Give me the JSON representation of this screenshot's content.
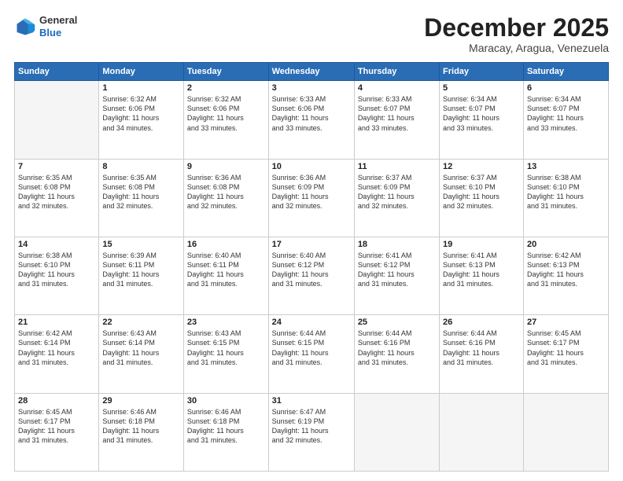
{
  "logo": {
    "line1": "General",
    "line2": "Blue"
  },
  "header": {
    "month": "December 2025",
    "location": "Maracay, Aragua, Venezuela"
  },
  "weekdays": [
    "Sunday",
    "Monday",
    "Tuesday",
    "Wednesday",
    "Thursday",
    "Friday",
    "Saturday"
  ],
  "weeks": [
    [
      {
        "day": "",
        "info": ""
      },
      {
        "day": "1",
        "info": "Sunrise: 6:32 AM\nSunset: 6:06 PM\nDaylight: 11 hours\nand 34 minutes."
      },
      {
        "day": "2",
        "info": "Sunrise: 6:32 AM\nSunset: 6:06 PM\nDaylight: 11 hours\nand 33 minutes."
      },
      {
        "day": "3",
        "info": "Sunrise: 6:33 AM\nSunset: 6:06 PM\nDaylight: 11 hours\nand 33 minutes."
      },
      {
        "day": "4",
        "info": "Sunrise: 6:33 AM\nSunset: 6:07 PM\nDaylight: 11 hours\nand 33 minutes."
      },
      {
        "day": "5",
        "info": "Sunrise: 6:34 AM\nSunset: 6:07 PM\nDaylight: 11 hours\nand 33 minutes."
      },
      {
        "day": "6",
        "info": "Sunrise: 6:34 AM\nSunset: 6:07 PM\nDaylight: 11 hours\nand 33 minutes."
      }
    ],
    [
      {
        "day": "7",
        "info": "Sunrise: 6:35 AM\nSunset: 6:08 PM\nDaylight: 11 hours\nand 32 minutes."
      },
      {
        "day": "8",
        "info": "Sunrise: 6:35 AM\nSunset: 6:08 PM\nDaylight: 11 hours\nand 32 minutes."
      },
      {
        "day": "9",
        "info": "Sunrise: 6:36 AM\nSunset: 6:08 PM\nDaylight: 11 hours\nand 32 minutes."
      },
      {
        "day": "10",
        "info": "Sunrise: 6:36 AM\nSunset: 6:09 PM\nDaylight: 11 hours\nand 32 minutes."
      },
      {
        "day": "11",
        "info": "Sunrise: 6:37 AM\nSunset: 6:09 PM\nDaylight: 11 hours\nand 32 minutes."
      },
      {
        "day": "12",
        "info": "Sunrise: 6:37 AM\nSunset: 6:10 PM\nDaylight: 11 hours\nand 32 minutes."
      },
      {
        "day": "13",
        "info": "Sunrise: 6:38 AM\nSunset: 6:10 PM\nDaylight: 11 hours\nand 31 minutes."
      }
    ],
    [
      {
        "day": "14",
        "info": "Sunrise: 6:38 AM\nSunset: 6:10 PM\nDaylight: 11 hours\nand 31 minutes."
      },
      {
        "day": "15",
        "info": "Sunrise: 6:39 AM\nSunset: 6:11 PM\nDaylight: 11 hours\nand 31 minutes."
      },
      {
        "day": "16",
        "info": "Sunrise: 6:40 AM\nSunset: 6:11 PM\nDaylight: 11 hours\nand 31 minutes."
      },
      {
        "day": "17",
        "info": "Sunrise: 6:40 AM\nSunset: 6:12 PM\nDaylight: 11 hours\nand 31 minutes."
      },
      {
        "day": "18",
        "info": "Sunrise: 6:41 AM\nSunset: 6:12 PM\nDaylight: 11 hours\nand 31 minutes."
      },
      {
        "day": "19",
        "info": "Sunrise: 6:41 AM\nSunset: 6:13 PM\nDaylight: 11 hours\nand 31 minutes."
      },
      {
        "day": "20",
        "info": "Sunrise: 6:42 AM\nSunset: 6:13 PM\nDaylight: 11 hours\nand 31 minutes."
      }
    ],
    [
      {
        "day": "21",
        "info": "Sunrise: 6:42 AM\nSunset: 6:14 PM\nDaylight: 11 hours\nand 31 minutes."
      },
      {
        "day": "22",
        "info": "Sunrise: 6:43 AM\nSunset: 6:14 PM\nDaylight: 11 hours\nand 31 minutes."
      },
      {
        "day": "23",
        "info": "Sunrise: 6:43 AM\nSunset: 6:15 PM\nDaylight: 11 hours\nand 31 minutes."
      },
      {
        "day": "24",
        "info": "Sunrise: 6:44 AM\nSunset: 6:15 PM\nDaylight: 11 hours\nand 31 minutes."
      },
      {
        "day": "25",
        "info": "Sunrise: 6:44 AM\nSunset: 6:16 PM\nDaylight: 11 hours\nand 31 minutes."
      },
      {
        "day": "26",
        "info": "Sunrise: 6:44 AM\nSunset: 6:16 PM\nDaylight: 11 hours\nand 31 minutes."
      },
      {
        "day": "27",
        "info": "Sunrise: 6:45 AM\nSunset: 6:17 PM\nDaylight: 11 hours\nand 31 minutes."
      }
    ],
    [
      {
        "day": "28",
        "info": "Sunrise: 6:45 AM\nSunset: 6:17 PM\nDaylight: 11 hours\nand 31 minutes."
      },
      {
        "day": "29",
        "info": "Sunrise: 6:46 AM\nSunset: 6:18 PM\nDaylight: 11 hours\nand 31 minutes."
      },
      {
        "day": "30",
        "info": "Sunrise: 6:46 AM\nSunset: 6:18 PM\nDaylight: 11 hours\nand 31 minutes."
      },
      {
        "day": "31",
        "info": "Sunrise: 6:47 AM\nSunset: 6:19 PM\nDaylight: 11 hours\nand 32 minutes."
      },
      {
        "day": "",
        "info": ""
      },
      {
        "day": "",
        "info": ""
      },
      {
        "day": "",
        "info": ""
      }
    ]
  ]
}
